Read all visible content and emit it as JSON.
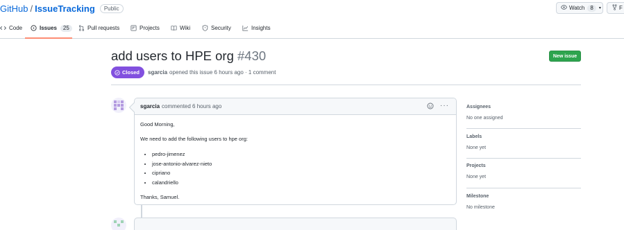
{
  "repo": {
    "owner": "GitHub",
    "separator": "/",
    "name": "IssueTracking",
    "visibility": "Public"
  },
  "actions": {
    "watch_label": "Watch",
    "watch_count": "8",
    "fork_label": "F"
  },
  "tabs": [
    {
      "label": "Code",
      "icon": "code-icon"
    },
    {
      "label": "Issues",
      "icon": "issue-icon",
      "count": "25",
      "selected": true
    },
    {
      "label": "Pull requests",
      "icon": "pull-request-icon"
    },
    {
      "label": "Projects",
      "icon": "project-icon"
    },
    {
      "label": "Wiki",
      "icon": "book-icon"
    },
    {
      "label": "Security",
      "icon": "shield-icon"
    },
    {
      "label": "Insights",
      "icon": "graph-icon"
    }
  ],
  "issue": {
    "title": "add users to HPE org",
    "number": "#430",
    "state": "Closed",
    "author": "sgarcia",
    "summary": "opened this issue 6 hours ago · 1 comment",
    "new_issue_label": "New issue"
  },
  "comment": {
    "author": "sgarcia",
    "time": "commented 6 hours ago",
    "greeting": "Good Morning,",
    "intro": "We need to add the following users to hpe org:",
    "users": [
      "pedro-jimenez",
      "jose-antonio-alvarez-nieto",
      "cipriano",
      "calandriello"
    ],
    "signoff": "Thanks, Samuel."
  },
  "sidebar": {
    "assignees": {
      "heading": "Assignees",
      "value": "No one assigned"
    },
    "labels": {
      "heading": "Labels",
      "value": "None yet"
    },
    "projects": {
      "heading": "Projects",
      "value": "None yet"
    },
    "milestone": {
      "heading": "Milestone",
      "value": "No milestone"
    }
  },
  "colors": {
    "link": "#0969da",
    "closed": "#8250df",
    "new_issue": "#2da44e",
    "tab_underline": "#fd8c73"
  }
}
